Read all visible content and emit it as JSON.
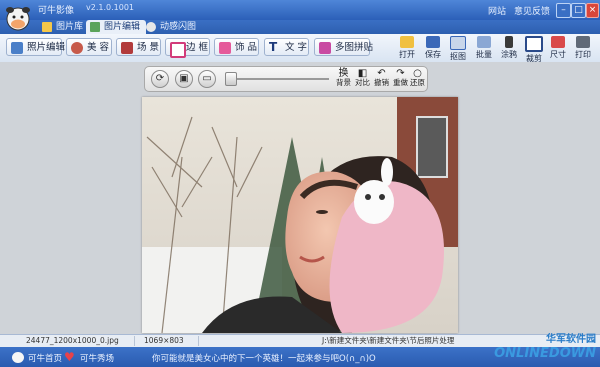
{
  "app": {
    "title": "可牛影像",
    "version": "v2.1.0.1001"
  },
  "title_links": {
    "forum": "网站",
    "feedback": "意见反馈"
  },
  "window_controls": {
    "minimize": "–",
    "maximize": "□",
    "close": "×"
  },
  "tabs": [
    {
      "label": "图片库",
      "active": false
    },
    {
      "label": "图片编辑",
      "active": true
    },
    {
      "label": "动感闪图",
      "active": false
    }
  ],
  "toolbar": {
    "left_buttons": [
      "照片编辑",
      "美 容",
      "场 景",
      "边 框",
      "饰 品",
      "文 字",
      "多图拼贴"
    ],
    "right_buttons": [
      "打开",
      "保存",
      "抠图",
      "批量",
      "涂鸦",
      "裁剪",
      "尺寸",
      "打印"
    ]
  },
  "edit_bar": {
    "buttons": [
      {
        "line1": "换",
        "line2": "背景"
      },
      {
        "line1": "",
        "line2": "对比"
      },
      {
        "line1": "",
        "line2": "撤销"
      },
      {
        "line1": "",
        "line2": "重做"
      },
      {
        "line1": "",
        "line2": "还原"
      }
    ]
  },
  "status": {
    "filename": "24477_1200x1000_0.jpg",
    "dimensions": "1069×803",
    "path": "J:\\新建文件夹\\新建文件夹\\节后照片处理"
  },
  "footer": {
    "home": "可牛首页",
    "show": "可牛秀场",
    "slogan": "你可能就是美女心中的下一个英雄！一起来参与吧O(∩_∩)O"
  },
  "watermark": {
    "cn": "华军软件园",
    "en": "ONLINEDOWN"
  },
  "colors": {
    "title_bar": "#2b5fb8",
    "toolbar": "#dfe8f4",
    "workspace": "#cfd3d8"
  }
}
